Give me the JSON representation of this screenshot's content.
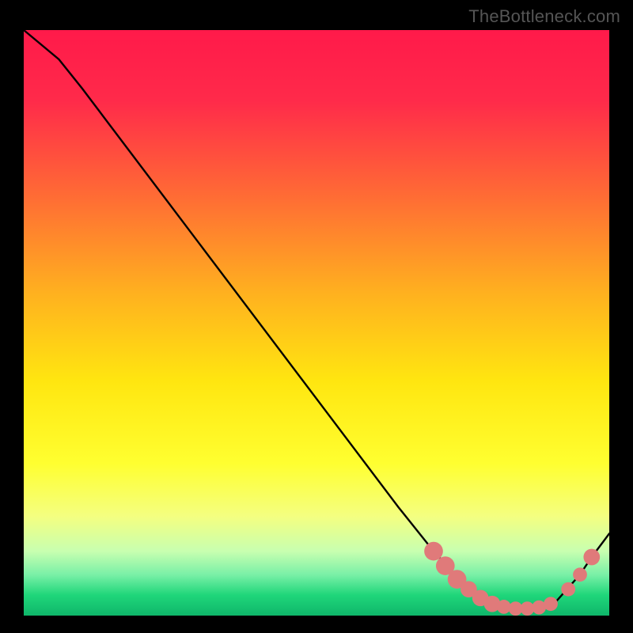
{
  "watermark": "TheBottleneck.com",
  "chart_data": {
    "type": "line",
    "title": "",
    "xlabel": "",
    "ylabel": "",
    "xlim": [
      0,
      100
    ],
    "ylim": [
      0,
      100
    ],
    "curve": [
      {
        "x": 0,
        "y": 100
      },
      {
        "x": 6,
        "y": 95
      },
      {
        "x": 10,
        "y": 90
      },
      {
        "x": 64,
        "y": 18.5
      },
      {
        "x": 70,
        "y": 11
      },
      {
        "x": 76,
        "y": 4.5
      },
      {
        "x": 80,
        "y": 2
      },
      {
        "x": 84,
        "y": 1.2
      },
      {
        "x": 88,
        "y": 1.2
      },
      {
        "x": 91,
        "y": 2.5
      },
      {
        "x": 95,
        "y": 7
      },
      {
        "x": 97,
        "y": 10
      },
      {
        "x": 100,
        "y": 14
      }
    ],
    "markers": [
      {
        "x": 70,
        "y": 11,
        "r": 1.6
      },
      {
        "x": 72,
        "y": 8.5,
        "r": 1.6
      },
      {
        "x": 74,
        "y": 6.2,
        "r": 1.6
      },
      {
        "x": 76,
        "y": 4.5,
        "r": 1.4
      },
      {
        "x": 78,
        "y": 3.0,
        "r": 1.4
      },
      {
        "x": 80,
        "y": 2.0,
        "r": 1.4
      },
      {
        "x": 82,
        "y": 1.5,
        "r": 1.2
      },
      {
        "x": 84,
        "y": 1.2,
        "r": 1.2
      },
      {
        "x": 86,
        "y": 1.2,
        "r": 1.2
      },
      {
        "x": 88,
        "y": 1.4,
        "r": 1.2
      },
      {
        "x": 90,
        "y": 2.0,
        "r": 1.2
      },
      {
        "x": 93,
        "y": 4.5,
        "r": 1.2
      },
      {
        "x": 95,
        "y": 7.0,
        "r": 1.2
      },
      {
        "x": 97,
        "y": 10.0,
        "r": 1.4
      }
    ],
    "gradient_stops": [
      {
        "offset": 0.0,
        "color": "#ff1a4a"
      },
      {
        "offset": 0.12,
        "color": "#ff2a4a"
      },
      {
        "offset": 0.28,
        "color": "#ff6a35"
      },
      {
        "offset": 0.45,
        "color": "#ffb11f"
      },
      {
        "offset": 0.6,
        "color": "#ffe610"
      },
      {
        "offset": 0.74,
        "color": "#ffff30"
      },
      {
        "offset": 0.83,
        "color": "#f4ff80"
      },
      {
        "offset": 0.89,
        "color": "#c8ffb0"
      },
      {
        "offset": 0.93,
        "color": "#7af0a7"
      },
      {
        "offset": 0.965,
        "color": "#1fd67a"
      },
      {
        "offset": 1.0,
        "color": "#0fb66a"
      }
    ],
    "marker_color": "#e07a7a",
    "line_color": "#000000"
  }
}
